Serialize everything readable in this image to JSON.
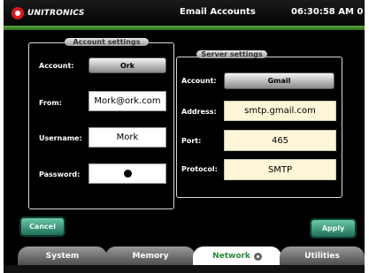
{
  "header": {
    "brand": "UNITRONICS",
    "title": "Email Accounts",
    "time": "06:30:58 AM  0"
  },
  "account_settings": {
    "title": "Account settings",
    "account_label": "Account:",
    "account_value": "Ork",
    "from_label": "From:",
    "from_value": "Mork@ork.com",
    "username_label": "Username:",
    "username_value": "Mork",
    "password_label": "Password:",
    "password_masked": "●"
  },
  "server_settings": {
    "title": "Server settings",
    "account_label": "Account:",
    "account_value": "Gmail",
    "address_label": "Address:",
    "address_value": "smtp.gmail.com",
    "port_label": "Port:",
    "port_value": "465",
    "protocol_label": "Protocol:",
    "protocol_value": "SMTP"
  },
  "buttons": {
    "cancel": "Cancel",
    "apply": "Apply"
  },
  "tabs": [
    {
      "label": "System",
      "active": false
    },
    {
      "label": "Memory",
      "active": false
    },
    {
      "label": "Network",
      "active": true
    },
    {
      "label": "Utilities",
      "active": false
    }
  ],
  "colors": {
    "accent_green": "#5aa53a",
    "button_teal": "#2f8f73",
    "field_cream": "#fdf6d8"
  }
}
